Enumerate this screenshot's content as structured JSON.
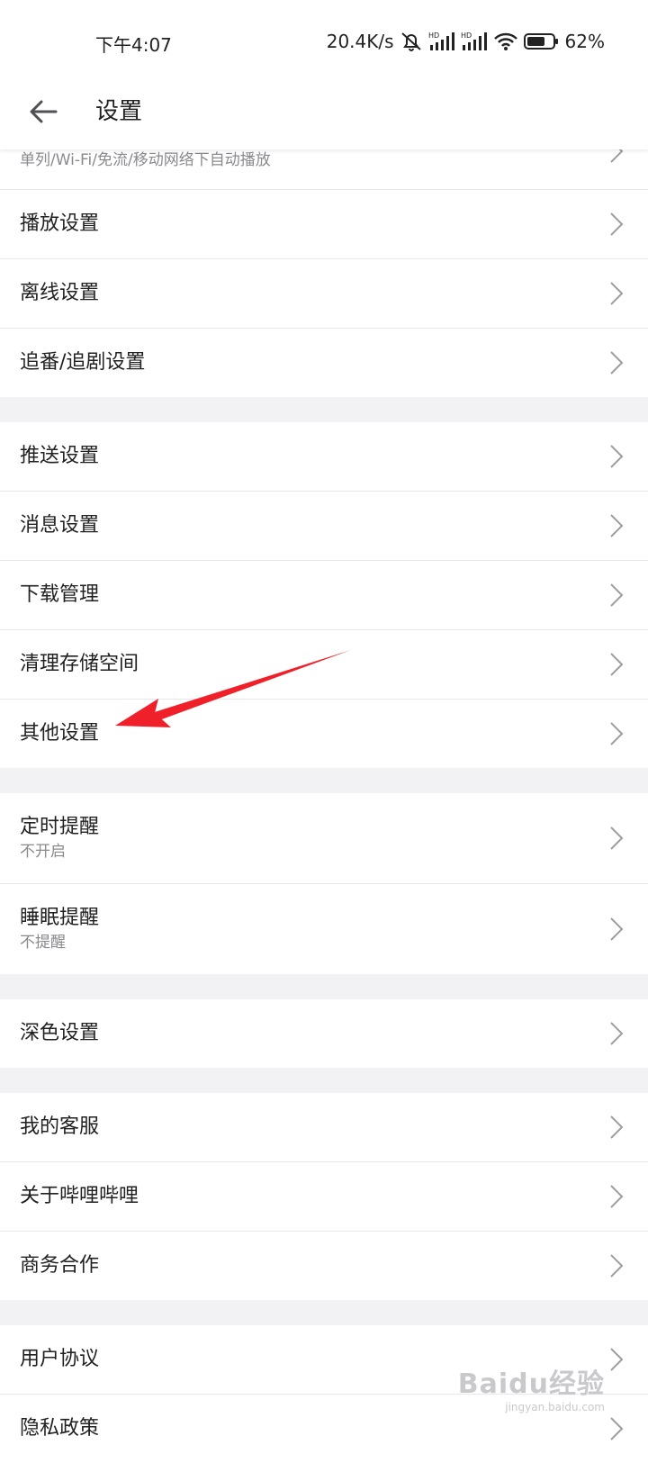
{
  "status_bar": {
    "time": "下午4:07",
    "net_speed": "20.4K/s",
    "battery_pct": "62%",
    "icons": [
      "mute-bell-icon",
      "hd-signal-icon",
      "hd-signal-icon",
      "wifi-icon",
      "battery-icon"
    ]
  },
  "header": {
    "title": "设置",
    "back_icon": "back-arrow-icon"
  },
  "sections": [
    {
      "items": [
        {
          "label": "",
          "sub": "单列/Wi-Fi/免流/移动网络下自动播放"
        },
        {
          "label": "播放设置"
        },
        {
          "label": "离线设置"
        },
        {
          "label": "追番/追剧设置"
        }
      ]
    },
    {
      "items": [
        {
          "label": "推送设置"
        },
        {
          "label": "消息设置"
        },
        {
          "label": "下载管理"
        },
        {
          "label": "清理存储空间"
        },
        {
          "label": "其他设置"
        }
      ]
    },
    {
      "items": [
        {
          "label": "定时提醒",
          "sub": "不开启"
        },
        {
          "label": "睡眠提醒",
          "sub": "不提醒"
        }
      ]
    },
    {
      "items": [
        {
          "label": "深色设置"
        }
      ]
    },
    {
      "items": [
        {
          "label": "我的客服"
        },
        {
          "label": "关于哔哩哔哩"
        },
        {
          "label": "商务合作"
        }
      ]
    },
    {
      "items": [
        {
          "label": "用户协议"
        },
        {
          "label": "隐私政策"
        }
      ]
    }
  ],
  "annotation": {
    "arrow_color": "#f0202a",
    "points_to": "其他设置"
  },
  "watermark": {
    "main": "Baidu经验",
    "sub": "jingyan.baidu.com"
  },
  "colors": {
    "text": "#212121",
    "subtext": "#8a8a8e",
    "divider": "#e8e8ea",
    "bg": "#f2f2f4",
    "chevron": "#9e9ea2"
  }
}
